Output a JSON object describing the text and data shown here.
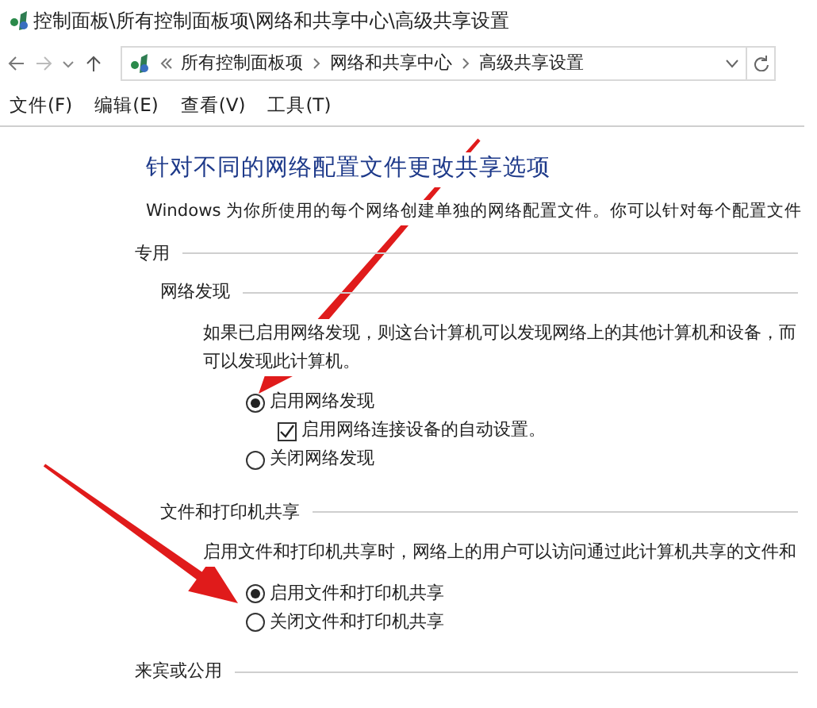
{
  "window": {
    "title": "控制面板\\所有控制面板项\\网络和共享中心\\高级共享设置"
  },
  "address_bar": {
    "crumbs": [
      "所有控制面板项",
      "网络和共享中心",
      "高级共享设置"
    ]
  },
  "menu": [
    "文件(F)",
    "编辑(E)",
    "查看(V)",
    "工具(T)"
  ],
  "heading": "针对不同的网络配置文件更改共享选项",
  "description": "Windows 为你所使用的每个网络创建单独的网络配置文件。你可以针对每个配置文件",
  "profiles": [
    {
      "title": "专用",
      "sections": [
        {
          "title": "网络发现",
          "text": [
            "如果已启用网络发现，则这台计算机可以发现网络上的其他计算机和设备，而",
            "可以发现此计算机。"
          ],
          "options": [
            {
              "kind": "radio",
              "label": "启用网络发现",
              "selected": true
            },
            {
              "kind": "checkbox",
              "label": "启用网络连接设备的自动设置。",
              "checked": true
            },
            {
              "kind": "radio",
              "label": "关闭网络发现",
              "selected": false
            }
          ]
        },
        {
          "title": "文件和打印机共享",
          "text": [
            "启用文件和打印机共享时，网络上的用户可以访问通过此计算机共享的文件和"
          ],
          "options": [
            {
              "kind": "radio",
              "label": "启用文件和打印机共享",
              "selected": true
            },
            {
              "kind": "radio",
              "label": "关闭文件和打印机共享",
              "selected": false
            }
          ]
        }
      ]
    },
    {
      "title": "来宾或公用"
    }
  ]
}
